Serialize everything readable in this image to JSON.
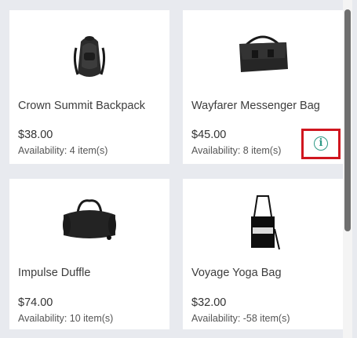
{
  "products": [
    {
      "name": "Crown Summit Backpack",
      "price": "$38.00",
      "availability": "Availability: 4 item(s)",
      "image": "backpack"
    },
    {
      "name": "Wayfarer Messenger Bag",
      "price": "$45.00",
      "availability": "Availability: 8 item(s)",
      "image": "messenger-bag"
    },
    {
      "name": "Impulse Duffle",
      "price": "$74.00",
      "availability": "Availability: 10 item(s)",
      "image": "duffle-bag"
    },
    {
      "name": "Voyage Yoga Bag",
      "price": "$32.00",
      "availability": "Availability: -58 item(s)",
      "image": "tote-bag"
    }
  ],
  "info_button": {
    "icon": "info-icon",
    "glyph": "i",
    "highlight_color": "#d0161f",
    "icon_color": "#2e9a86"
  },
  "scrollbar": {
    "position_fraction": 0.0
  }
}
